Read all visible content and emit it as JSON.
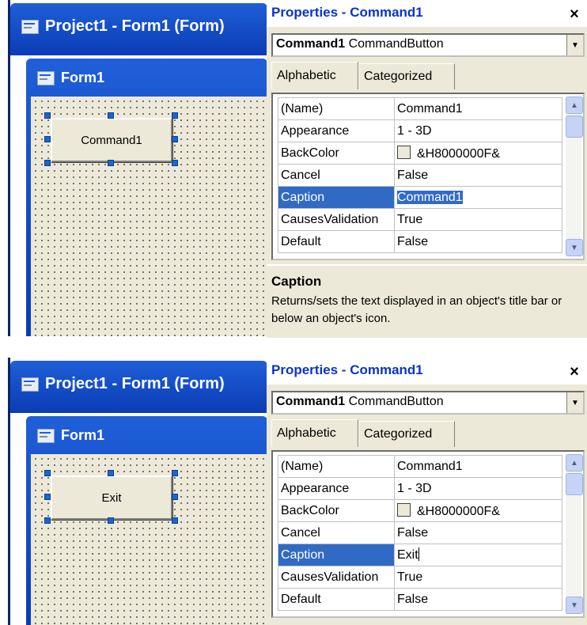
{
  "panels": [
    {
      "project_title": "Project1 - Form1 (Form)",
      "form_title": "Form1",
      "button_caption": "Command1",
      "props_title": "Properties - Command1",
      "object_name": "Command1",
      "object_type": "CommandButton",
      "tabs": [
        "Alphabetic",
        "Categorized"
      ],
      "rows": [
        {
          "key": "(Name)",
          "value": "Command1"
        },
        {
          "key": "Appearance",
          "value": "1 - 3D"
        },
        {
          "key": "BackColor",
          "value": "&H8000000F&"
        },
        {
          "key": "Cancel",
          "value": "False"
        },
        {
          "key": "Caption",
          "value": "Command1"
        },
        {
          "key": "CausesValidation",
          "value": "True"
        },
        {
          "key": "Default",
          "value": "False"
        }
      ],
      "desc_title": "Caption",
      "desc_text": "Returns/sets the text displayed in an object's title bar or below an object's icon."
    },
    {
      "project_title": "Project1 - Form1 (Form)",
      "form_title": "Form1",
      "button_caption": "Exit",
      "props_title": "Properties - Command1",
      "object_name": "Command1",
      "object_type": "CommandButton",
      "tabs": [
        "Alphabetic",
        "Categorized"
      ],
      "rows": [
        {
          "key": "(Name)",
          "value": "Command1"
        },
        {
          "key": "Appearance",
          "value": "1 - 3D"
        },
        {
          "key": "BackColor",
          "value": "&H8000000F&"
        },
        {
          "key": "Cancel",
          "value": "False"
        },
        {
          "key": "Caption",
          "value": "Exit"
        },
        {
          "key": "CausesValidation",
          "value": "True"
        },
        {
          "key": "Default",
          "value": "False"
        }
      ]
    }
  ],
  "close_glyph": "×",
  "colors": {
    "title_blue": "#0a34c8",
    "selection": "#316ac5",
    "form_bg": "#ece9d8"
  }
}
